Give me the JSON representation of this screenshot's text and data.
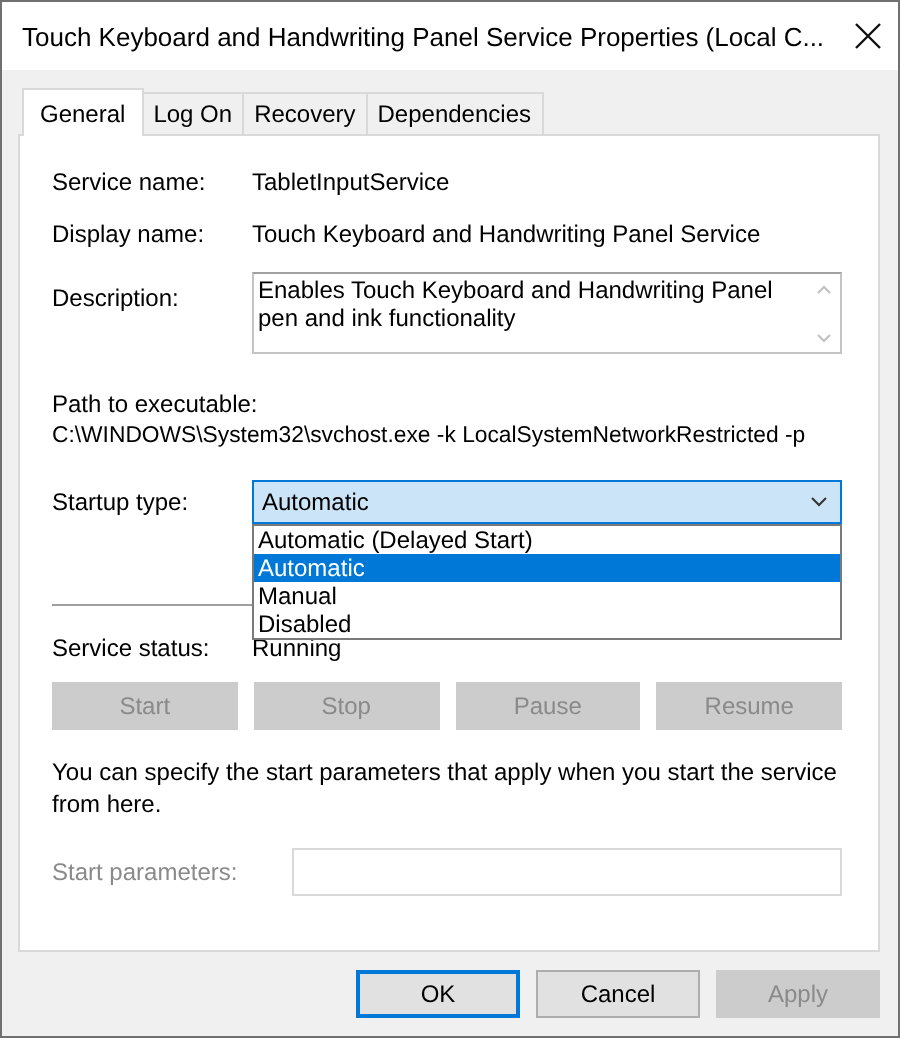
{
  "window": {
    "title": "Touch Keyboard and Handwriting Panel Service Properties (Local C..."
  },
  "tabs": [
    {
      "label": "General",
      "selected": true
    },
    {
      "label": "Log On",
      "selected": false
    },
    {
      "label": "Recovery",
      "selected": false
    },
    {
      "label": "Dependencies",
      "selected": false
    }
  ],
  "service_name": {
    "label": "Service name:",
    "value": "TabletInputService"
  },
  "display_name": {
    "label": "Display name:",
    "value": "Touch Keyboard and Handwriting Panel Service"
  },
  "description": {
    "label": "Description:",
    "value": "Enables Touch Keyboard and Handwriting Panel pen and ink functionality"
  },
  "path": {
    "label": "Path to executable:",
    "value": "C:\\WINDOWS\\System32\\svchost.exe -k LocalSystemNetworkRestricted -p"
  },
  "startup_type": {
    "label": "Startup type:",
    "value": "Automatic",
    "expanded": true,
    "options": [
      {
        "label": "Automatic (Delayed Start)",
        "selected": false
      },
      {
        "label": "Automatic",
        "selected": true
      },
      {
        "label": "Manual",
        "selected": false
      },
      {
        "label": "Disabled",
        "selected": false
      }
    ]
  },
  "service_status": {
    "label": "Service status:",
    "value": "Running"
  },
  "service_buttons": [
    {
      "label": "Start",
      "disabled": true
    },
    {
      "label": "Stop",
      "disabled": true
    },
    {
      "label": "Pause",
      "disabled": true
    },
    {
      "label": "Resume",
      "disabled": true
    }
  ],
  "hint": "You can specify the start parameters that apply when you start the service from here.",
  "start_parameters": {
    "label": "Start parameters:",
    "disabled": true
  },
  "dialog_buttons": [
    {
      "label": "OK",
      "default": true,
      "disabled": false
    },
    {
      "label": "Cancel",
      "default": false,
      "disabled": false
    },
    {
      "label": "Apply",
      "default": false,
      "disabled": true
    }
  ]
}
